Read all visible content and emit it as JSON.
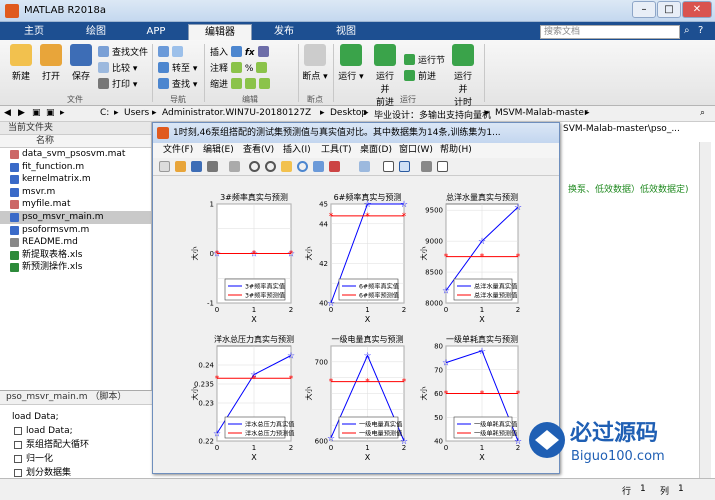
{
  "window": {
    "title": "MATLAB R2018a"
  },
  "tabs": [
    "主页",
    "绘图",
    "APP",
    "编辑器",
    "发布",
    "视图"
  ],
  "search": {
    "placeholder": "搜索文档"
  },
  "ribbon": {
    "new": "新建",
    "open": "打开",
    "save": "保存",
    "find_files": "查找文件",
    "compare": "比较",
    "print": "打印",
    "goto": "转至",
    "find": "查找",
    "insert": "插入",
    "comment": "注释",
    "indent": "缩进",
    "breakpoints": "断点",
    "run": "运行",
    "run_advance": "运行并\n前进",
    "run_section": "运行节",
    "advance": "前进",
    "run_time": "运行并\n计时",
    "groups": {
      "file": "文件",
      "nav": "导航",
      "edit": "编辑",
      "bp": "断点",
      "run": "运行"
    }
  },
  "address": {
    "parts": [
      "C:",
      "Users",
      "Administrator.WIN7U-20180127Z",
      "Desktop",
      "毕业设计：多输出支持向量机",
      "MSVM-Malab-master"
    ]
  },
  "current_folder": {
    "header": "当前文件夹",
    "col": "名称",
    "files": [
      {
        "name": "data_svm_psosvm.mat",
        "color": "#c66"
      },
      {
        "name": "fit_function.m",
        "color": "#3a6ac8"
      },
      {
        "name": "kernelmatrix.m",
        "color": "#3a6ac8"
      },
      {
        "name": "msvr.m",
        "color": "#3a6ac8"
      },
      {
        "name": "myfile.mat",
        "color": "#c66"
      },
      {
        "name": "pso_msvr_main.m",
        "color": "#3a6ac8",
        "selected": true
      },
      {
        "name": "psoformsvm.m",
        "color": "#3a6ac8"
      },
      {
        "name": "README.md",
        "color": "#888"
      },
      {
        "name": "新提取表格.xls",
        "color": "#2d8a3a"
      },
      {
        "name": "新预测操作.xls",
        "color": "#2d8a3a"
      }
    ]
  },
  "details": {
    "title": "pso_msvr_main.m （脚本）",
    "line1": "load Data;",
    "items": [
      "load Data;",
      "泵组搭配大循环",
      "归一化",
      "划分数据集"
    ]
  },
  "editor": {
    "tab_path": "SVM-Malab-master\\pso_...",
    "code_comment": "换泵、低效数据）低效数据定)"
  },
  "figure": {
    "title": "1时刻,46泵组搭配的测试集预测值与真实值对比。其中数据集为14条,训练集为1...",
    "menu": [
      "文件(F)",
      "编辑(E)",
      "查看(V)",
      "插入(I)",
      "工具(T)",
      "桌面(D)",
      "窗口(W)",
      "帮助(H)"
    ]
  },
  "status": {
    "line_label": "行",
    "line_value": "1",
    "col_label": "列",
    "col_value": "1"
  },
  "watermark": {
    "text": "必过源码",
    "url": "Biguo100.com"
  },
  "colors": {
    "true_series": "#0000ff",
    "pred_series": "#ff0000"
  },
  "chart_data": [
    {
      "type": "line",
      "title": "3#频率真实与预测",
      "xlabel": "X",
      "ylabel": "大小",
      "xlim": [
        0,
        2
      ],
      "ylim": [
        -1,
        1
      ],
      "yticks": [
        -1,
        -0.5,
        0,
        0.5,
        1
      ],
      "yticklabels": [
        "-1",
        "",
        "0",
        "",
        "1"
      ],
      "xticks": [
        0,
        1,
        2
      ],
      "series": [
        {
          "name": "3#频率真实值",
          "x": [
            0,
            1,
            2
          ],
          "values": [
            0,
            0,
            0
          ]
        },
        {
          "name": "3#频率预测值",
          "x": [
            0,
            1,
            2
          ],
          "values": [
            0,
            0,
            0
          ]
        }
      ],
      "legend": "bottom"
    },
    {
      "type": "line",
      "title": "6#频率真实与预测",
      "xlabel": "X",
      "ylabel": "大小",
      "xlim": [
        0,
        2
      ],
      "ylim": [
        40,
        45
      ],
      "yticks": [
        40,
        41,
        42,
        43,
        44,
        45
      ],
      "yticklabels": [
        "40",
        "",
        "42",
        "",
        "44",
        "45"
      ],
      "xticks": [
        0,
        1,
        2
      ],
      "series": [
        {
          "name": "6#频率真实值",
          "x": [
            0,
            1,
            2
          ],
          "values": [
            40,
            45,
            45
          ]
        },
        {
          "name": "6#频率预测值",
          "x": [
            0,
            1,
            2
          ],
          "values": [
            44.4,
            44.4,
            44.4
          ]
        }
      ],
      "legend": "bottom"
    },
    {
      "type": "line",
      "title": "总洋水量真实与预测",
      "xlabel": "X",
      "ylabel": "大小",
      "xlim": [
        0,
        2
      ],
      "ylim": [
        8000,
        9600
      ],
      "yticks": [
        8000,
        8500,
        9000,
        9500
      ],
      "yticklabels": [
        "8000",
        "8500",
        "9000",
        "9500"
      ],
      "xticks": [
        0,
        1,
        2
      ],
      "series": [
        {
          "name": "总洋水量真实值",
          "x": [
            0,
            1,
            2
          ],
          "values": [
            8200,
            9000,
            9550
          ]
        },
        {
          "name": "总洋水量预测值",
          "x": [
            0,
            1,
            2
          ],
          "values": [
            8750,
            8750,
            8750
          ]
        }
      ],
      "legend": "bottom"
    },
    {
      "type": "line",
      "title": "洋水总压力真实与预测",
      "xlabel": "X",
      "ylabel": "大小",
      "xlim": [
        0,
        2
      ],
      "ylim": [
        0.22,
        0.245
      ],
      "yticks": [
        0.22,
        0.225,
        0.23,
        0.235,
        0.24
      ],
      "yticklabels": [
        "0.22",
        "",
        "0.23",
        "0.235",
        "0.24"
      ],
      "xticks": [
        0,
        1,
        2
      ],
      "series": [
        {
          "name": "洋水总压力真实值",
          "x": [
            0,
            1,
            2
          ],
          "values": [
            0.222,
            0.2375,
            0.2425
          ]
        },
        {
          "name": "洋水总压力预测值",
          "x": [
            0,
            1,
            2
          ],
          "values": [
            0.2365,
            0.2365,
            0.2365
          ]
        }
      ],
      "legend": "bottom"
    },
    {
      "type": "line",
      "title": "一级电量真实与预测",
      "xlabel": "X",
      "ylabel": "大小",
      "xlim": [
        0,
        2
      ],
      "ylim": [
        600,
        720
      ],
      "yticks": [
        600,
        620,
        640,
        660,
        680,
        700,
        720
      ],
      "yticklabels": [
        "600",
        "",
        "",
        "",
        "",
        "700",
        ""
      ],
      "xticks": [
        0,
        1,
        2
      ],
      "series": [
        {
          "name": "一级电量真实值",
          "x": [
            0,
            1,
            2
          ],
          "values": [
            604,
            708,
            600
          ]
        },
        {
          "name": "一级电量预测值",
          "x": [
            0,
            1,
            2
          ],
          "values": [
            675,
            675,
            675
          ]
        }
      ],
      "legend": "bottom"
    },
    {
      "type": "line",
      "title": "一级单耗真实与预测",
      "xlabel": "X",
      "ylabel": "大小",
      "xlim": [
        0,
        2
      ],
      "ylim": [
        40,
        80
      ],
      "yticks": [
        40,
        50,
        60,
        70,
        80
      ],
      "yticklabels": [
        "40",
        "50",
        "60",
        "70",
        "80"
      ],
      "xticks": [
        0,
        1,
        2
      ],
      "series": [
        {
          "name": "一级单耗真实值",
          "x": [
            0,
            1,
            2
          ],
          "values": [
            73,
            78,
            40
          ]
        },
        {
          "name": "一级单耗预测值",
          "x": [
            0,
            1,
            2
          ],
          "values": [
            60,
            60,
            60
          ]
        }
      ],
      "legend": "bottom"
    }
  ]
}
